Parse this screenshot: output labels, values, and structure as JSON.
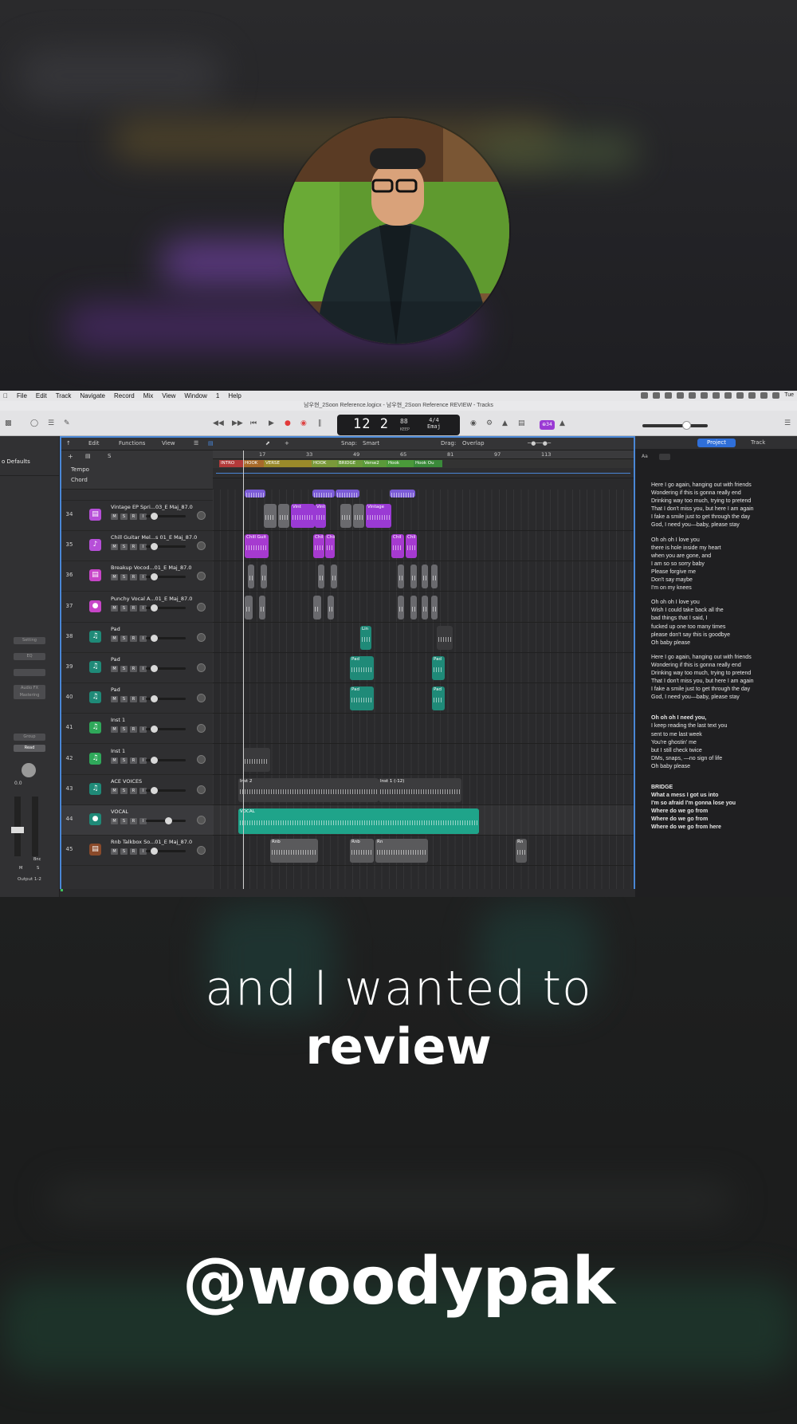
{
  "menu": {
    "items": [
      "File",
      "Edit",
      "Track",
      "Navigate",
      "Record",
      "Mix",
      "View",
      "Window",
      "1",
      "Help"
    ],
    "clock": "Tue"
  },
  "window_title": "남우현_2Soon Reference.logicx - 남우현_2Soon Reference REVIEW - Tracks",
  "lcd": {
    "bar": "12",
    "beat": "2",
    "tempo": "88",
    "tempo_label": "KEEP",
    "sig": "4/4",
    "key": "Emaj"
  },
  "toolbar": {
    "badge": "⊕34"
  },
  "editor_bar": {
    "edit": "Edit",
    "functions": "Functions",
    "view": "View",
    "snap_label": "Snap:",
    "snap_value": "Smart",
    "drag_label": "Drag:",
    "drag_value": "Overlap"
  },
  "inspector": {
    "defaults": "o Defaults",
    "setting": "Setting",
    "eq": "EQ",
    "audio_fx": "Audio FX",
    "mastering": "Mastering",
    "group": "Group",
    "read": "Read",
    "value": "0.0",
    "bounce": "Bnc",
    "output": "Output 1-2",
    "m": "M",
    "s": "S"
  },
  "global_tracks": {
    "tempo": "Tempo",
    "chord": "Chord"
  },
  "ruler": [
    "17",
    "33",
    "49",
    "65",
    "81",
    "97",
    "113"
  ],
  "markers": [
    "INTRO",
    "HOOK",
    "VERSE",
    "HOOK",
    "BRIDGE",
    "Verse2",
    "Hook",
    "Hook Ou"
  ],
  "tracks": [
    {
      "num": "34",
      "name": "Vintage EP Spri...03_E Maj_87.0",
      "color": "#b64fd8",
      "icon": "keyboard-icon"
    },
    {
      "num": "35",
      "name": "Chill Guitar Mel...s 01_E Maj_87.0",
      "color": "#b64fd8",
      "icon": "guitar-icon"
    },
    {
      "num": "36",
      "name": "Breakup Vocod...01_E Maj_87.0",
      "color": "#c745c8",
      "icon": "keyboard-icon"
    },
    {
      "num": "37",
      "name": "Punchy Vocal A...01_E Maj_87.0",
      "color": "#c745c8",
      "icon": "microphone-icon"
    },
    {
      "num": "38",
      "name": "Pad",
      "color": "#1f8a78",
      "icon": "synth-icon"
    },
    {
      "num": "39",
      "name": "Pad",
      "color": "#1f8a78",
      "icon": "synth-icon"
    },
    {
      "num": "40",
      "name": "Pad",
      "color": "#1f8a78",
      "icon": "synth-icon"
    },
    {
      "num": "41",
      "name": "Inst 1",
      "color": "#2fa85a",
      "icon": "synth-icon"
    },
    {
      "num": "42",
      "name": "Inst 1",
      "color": "#2fa85a",
      "icon": "synth-icon"
    },
    {
      "num": "43",
      "name": "ACE VOICES",
      "color": "#1f8a78",
      "icon": "synth-icon"
    },
    {
      "num": "44",
      "name": "VOCAL",
      "color": "#1f8a78",
      "icon": "microphone-icon"
    },
    {
      "num": "45",
      "name": "Rnb Talkbox So...01_E Maj_87.0",
      "color": "#8a4a2a",
      "icon": "keyboard-icon"
    }
  ],
  "msr": [
    "M",
    "S",
    "R",
    "I"
  ],
  "region_labels": {
    "vint": "Vint",
    "vintage": "Vintage",
    "chill_guit": "Chill Guit",
    "chil": "Chil",
    "lin": "Lin",
    "pad": "Pad",
    "inst2": "Inst 2",
    "inst1": "Inst 1 (-12)",
    "vocal": "VOCAL",
    "rnb": "Rnb",
    "rnb_short": "Rn"
  },
  "lyrics_tabs": {
    "project": "Project",
    "track": "Track",
    "aa": "Aa"
  },
  "lyrics": [
    "Here I go again, hanging out with friends",
    "Wondering if this is gonna really end",
    "Drinking way too much, trying to pretend",
    "That I don't miss you, but here I am again",
    "I fake a smile just to get through the day",
    "God, I need you—baby, please stay",
    "",
    "Oh oh oh I love you",
    "there is hole inside my heart",
    "when you are gone, and",
    "I am so so sorry baby",
    "Please forgive me",
    "Don't say maybe",
    "I'm on my knees",
    "",
    "Oh oh oh I love you",
    "Wish I could take back all the",
    "bad things that I said, I",
    "fucked up one too many times",
    "please don't say this is goodbye",
    "Oh baby please",
    "",
    "Here I go again, hanging out with friends",
    "Wondering if this is gonna really end",
    "Drinking way too much, trying to pretend",
    "That I don't miss you, but here I am again",
    "I fake a smile just to get through the day",
    "God, I need you—baby, please stay",
    "",
    "",
    "Oh oh oh I need you,",
    "I keep reading the last text you",
    "sent to me last week",
    "You're ghostin' me",
    "but I still check twice",
    "DMs, snaps, —no sign of life",
    "Oh baby please",
    "",
    "",
    "BRIDGE",
    "What a mess I got us into",
    "I'm so afraid I'm gonna lose you",
    "Where do we go from",
    "Where do we go from",
    "Where do we go from here"
  ],
  "caption": {
    "line1": "and I wanted to",
    "line2": "review",
    "handle": "@woodypak"
  }
}
